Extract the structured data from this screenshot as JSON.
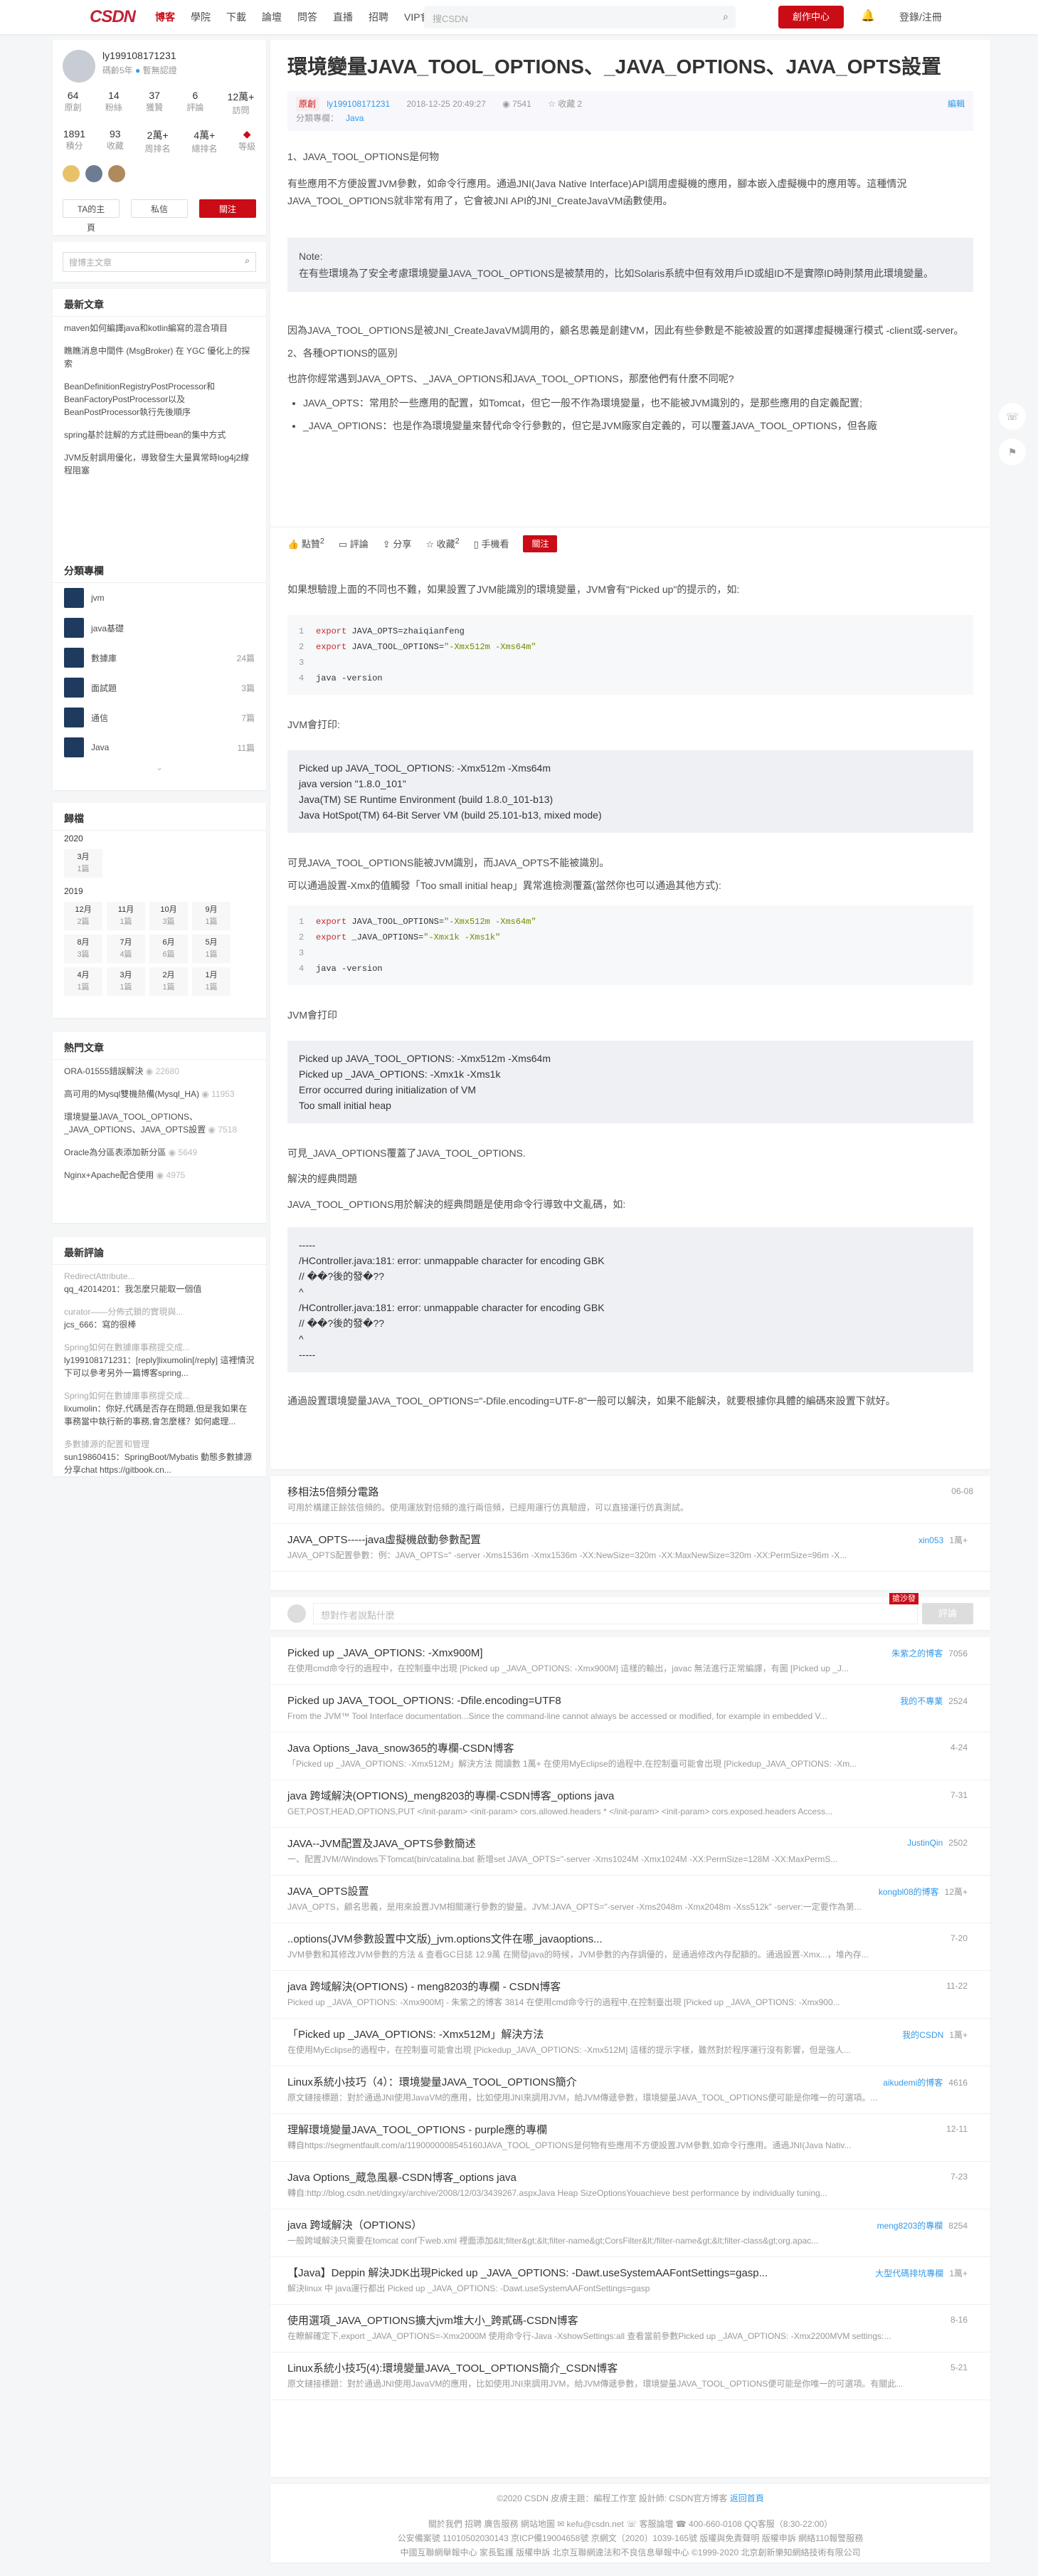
{
  "topbar": {
    "logo": "CSDN",
    "nav": [
      "博客",
      "學院",
      "下載",
      "論壇",
      "問答",
      "直播",
      "招聘",
      "VIP會員"
    ],
    "search_placeholder": "搜CSDN",
    "creator": "創作中心",
    "login": "登錄/注冊"
  },
  "author": {
    "name": "ly199108171231",
    "code_age": "碼齡5年",
    "badge": "暫無認證",
    "stats": [
      {
        "v": "64",
        "l": "原創"
      },
      {
        "v": "14",
        "l": "粉絲"
      },
      {
        "v": "37",
        "l": "獲贊"
      },
      {
        "v": "6",
        "l": "評論"
      },
      {
        "v": "12萬+",
        "l": "訪問"
      }
    ],
    "stats2": [
      {
        "v": "1891",
        "l": "積分"
      },
      {
        "v": "93",
        "l": "收藏"
      },
      {
        "v": "2萬+",
        "l": "周排名"
      },
      {
        "v": "4萬+",
        "l": "總排名"
      },
      {
        "v": "",
        "l": "等級"
      }
    ],
    "btn_home": "TA的主頁",
    "btn_msg": "私信",
    "btn_follow": "關注"
  },
  "sidebar_search": "搜博主文章",
  "recent": {
    "title": "最新文章",
    "items": [
      "maven如何編譯java和kotlin編寫的混合項目",
      "瞧瞧消息中間件 (MsgBroker) 在 YGC 優化上的探索",
      "BeanDefinitionRegistryPostProcessor和BeanFactoryPostProcessor以及BeanPostProcessor執行先後順序",
      "spring基於註解的方式註冊bean的集中方式",
      "JVM反射調用優化，導致發生大量異常時log4j2線程阻塞"
    ]
  },
  "categories": {
    "title": "分類專欄",
    "items": [
      {
        "n": "jvm",
        "c": ""
      },
      {
        "n": "java基礎",
        "c": ""
      },
      {
        "n": "數據庫",
        "c": "24篇"
      },
      {
        "n": "面試題",
        "c": "3篇"
      },
      {
        "n": "通信",
        "c": "7篇"
      },
      {
        "n": "Java",
        "c": "11篇"
      }
    ]
  },
  "archive": {
    "title": "歸檔",
    "years": [
      {
        "y": "2020",
        "m": [
          {
            "m": "3月",
            "c": "1篇"
          }
        ]
      },
      {
        "y": "2019",
        "m": [
          {
            "m": "12月",
            "c": "2篇"
          },
          {
            "m": "11月",
            "c": "1篇"
          },
          {
            "m": "10月",
            "c": "3篇"
          },
          {
            "m": "9月",
            "c": "1篇"
          },
          {
            "m": "8月",
            "c": "3篇"
          },
          {
            "m": "7月",
            "c": "4篇"
          },
          {
            "m": "6月",
            "c": "6篇"
          },
          {
            "m": "5月",
            "c": "1篇"
          },
          {
            "m": "4月",
            "c": "1篇"
          },
          {
            "m": "3月",
            "c": "1篇"
          },
          {
            "m": "2月",
            "c": "1篇"
          },
          {
            "m": "1月",
            "c": "1篇"
          }
        ]
      }
    ]
  },
  "hot": {
    "title": "熱門文章",
    "items": [
      {
        "t": "ORA-01555錯誤解決",
        "v": "22680"
      },
      {
        "t": "高可用的Mysql雙機熱備(Mysql_HA)",
        "v": "11953"
      },
      {
        "t": "環境變量JAVA_TOOL_OPTIONS、_JAVA_OPTIONS、JAVA_OPTS設置",
        "v": "7518"
      },
      {
        "t": "Oracle為分區表添加新分區",
        "v": "5649"
      },
      {
        "t": "Nginx+Apache配合使用",
        "v": "4975"
      }
    ]
  },
  "comments": {
    "title": "最新評論",
    "items": [
      {
        "a": "RedirectAttribute...",
        "t": "qq_42014201：我怎麼只能取一個值"
      },
      {
        "a": "curator——分佈式鎖的實現與...",
        "t": "jcs_666：寫的很棒"
      },
      {
        "a": "Spring如何在數據庫事務提交成...",
        "t": "ly199108171231：[reply]lixumolin[/reply] 這裡情況下可以參考另外一篇博客spring..."
      },
      {
        "a": "Spring如何在數據庫事務提交成...",
        "t": "lixumolin：你好,代碼是否存在問題,但是我如果在事務當中執行新的事務,會怎麼樣？如何處理..."
      },
      {
        "a": "多數據源的配置和管理",
        "t": "sun19860415：SpringBoot/Mybatis 動態多數據源分享chat https://gitbook.cn..."
      }
    ]
  },
  "article": {
    "title": "環境變量JAVA_TOOL_OPTIONS、_JAVA_OPTIONS、JAVA_OPTS設置",
    "tag": "原創",
    "author": "ly199108171231",
    "date": "2018-12-25 20:49:27",
    "views": "7541",
    "fav": "收藏 2",
    "edit": "編輯",
    "col_label": "分類專欄：",
    "col": "Java",
    "s1": "1、JAVA_TOOL_OPTIONS是何物",
    "p1": "有些應用不方便設置JVM參數，如命令行應用。通過JNI(Java Native Interface)API調用虛擬機的應用，腳本嵌入虛擬機中的應用等。這種情況JAVA_TOOL_OPTIONS就非常有用了，它會被JNI API的JNI_CreateJavaVM函數使用。",
    "note": [
      "Note:",
      "在有些環境為了安全考慮環境變量JAVA_TOOL_OPTIONS是被禁用的，比如Solaris系統中但有效用戶ID或組ID不是實際ID時則禁用此環境變量。"
    ],
    "p2": "因為JAVA_TOOL_OPTIONS是被JNI_CreateJavaVM調用的，顧名思義是創建VM，因此有些參數是不能被設置的如選擇虛擬機運行模式 -client或-server。",
    "s2": "2、各種OPTIONS的區別",
    "p3": "也許你經常遇到JAVA_OPTS、_JAVA_OPTIONS和JAVA_TOOL_OPTIONS，那麼他們有什麼不同呢?",
    "b1": "JAVA_OPTS：常用於一些應用的配置，如Tomcat，但它一般不作為環境變量，也不能被JVM識別的，是那些應用的自定義配置;",
    "b2": "_JAVA_OPTIONS：也是作為環境變量來替代命令行參數的，但它是JVM廠家自定義的，可以覆蓋JAVA_TOOL_OPTIONS，但各廠",
    "p4": "如果想驗證上面的不同也不難，如果設置了JVM能識別的環境變量，JVM會有\"Picked up\"的提示的，如:",
    "code1": [
      [
        "1",
        "export ",
        "JAVA_OPTS=zhaiqianfeng",
        ""
      ],
      [
        "2",
        "export ",
        "JAVA_TOOL_OPTIONS=",
        "\"-Xmx512m -Xms64m\""
      ],
      [
        "3",
        "",
        "",
        ""
      ],
      [
        "4",
        "",
        "java -version",
        ""
      ]
    ],
    "p5": "JVM會打印:",
    "out1": [
      "Picked up JAVA_TOOL_OPTIONS: -Xmx512m -Xms64m",
      "java version \"1.8.0_101\"",
      "Java(TM) SE Runtime Environment (build 1.8.0_101-b13)",
      "Java HotSpot(TM) 64-Bit Server VM (build 25.101-b13, mixed mode)"
    ],
    "p6": "可見JAVA_TOOL_OPTIONS能被JVM識別，而JAVA_OPTS不能被識別。",
    "p7": "可以通過設置-Xmx的值觸發「Too small initial heap」異常進檢測覆蓋(當然你也可以通過其他方式):",
    "code2": [
      [
        "1",
        "export ",
        "JAVA_TOOL_OPTIONS=",
        "\"-Xmx512m -Xms64m\""
      ],
      [
        "2",
        "export ",
        "_JAVA_OPTIONS=",
        "\"-Xmx1k -Xms1k\""
      ],
      [
        "3",
        "",
        "",
        ""
      ],
      [
        "4",
        "",
        "java -version",
        ""
      ]
    ],
    "p8": "JVM會打印",
    "out2": [
      "Picked up JAVA_TOOL_OPTIONS: -Xmx512m -Xms64m",
      "Picked up _JAVA_OPTIONS: -Xmx1k -Xms1k",
      "Error occurred during initialization of VM",
      "Too small initial heap"
    ],
    "p9": "可見_JAVA_OPTIONS覆蓋了JAVA_TOOL_OPTIONS.",
    "s3": "解決的經典問題",
    "p10": "JAVA_TOOL_OPTIONS用於解決的經典問題是使用命令行導致中文亂碼，如:",
    "out3": [
      "-----",
      "/HController.java:181: error: unmappable character for encoding GBK",
      "// ��?後的發�??",
      "^",
      "/HController.java:181: error: unmappable character for encoding GBK",
      "// ��?後的發�??",
      "^",
      "-----"
    ],
    "p11": "通過設置環境變量JAVA_TOOL_OPTIONS=\"-Dfile.encoding=UTF-8\"一般可以解決，如果不能解決，就要根據你具體的編碼來設置下就好。"
  },
  "actions": {
    "like": "點贊",
    "like_n": "2",
    "comment": "評論",
    "share": "分享",
    "fav": "收藏",
    "fav_n": "2",
    "phone": "手機看",
    "follow": "關注"
  },
  "recbox": [
    {
      "t": "移相法5倍頻分電路",
      "d": "可用於構建正餘弦倍頻的。使用運放對倍頻的進行兩倍頻，已經用運行仿真驗證，可以直接運行仿真測試。",
      "r": "06-08",
      "a": ""
    },
    {
      "t": "JAVA_OPTS-----java虛擬機啟動參數配置",
      "d": "JAVA_OPTS配置參數：例：JAVA_OPTS=\" -server -Xms1536m -Xmx1536m -XX:NewSize=320m -XX:MaxNewSize=320m -XX:PermSize=96m -X...",
      "r": "1萬+",
      "a": "xin053"
    }
  ],
  "comment_box": {
    "placeholder": "想對作者說點什麼",
    "btn": "評論",
    "badge": "搶沙發"
  },
  "recs": [
    {
      "t": "Picked up _JAVA_OPTIONS: -Xmx900M]",
      "d": "在使用cmd命令行的過程中，在控制臺中出現 [Picked up _JAVA_OPTIONS: -Xmx900M] 這樣的輸出，javac 無法進行正常編譯，有圖 [Picked up _J...",
      "a": "朱紫之的博客",
      "r": "7056"
    },
    {
      "t": "Picked up JAVA_TOOL_OPTIONS: -Dfile.encoding=UTF8",
      "d": "From the JVM™ Tool Interface documentation...Since the command-line cannot always be accessed or modified, for example in embedded V...",
      "a": "我的不專業",
      "r": "2524"
    },
    {
      "t": "Java Options_Java_snow365的專欄-CSDN博客",
      "d": "「Picked up _JAVA_OPTIONS: -Xmx512M」解決方法 閱讀數 1萬+ 在使用MyEclipse的過程中,在控制臺可能會出現 [Pickedup_JAVA_OPTIONS: -Xm...",
      "a": "",
      "r": "4-24"
    },
    {
      "t": "java 跨域解決(OPTIONS)_meng8203的專欄-CSDN博客_options java",
      "d": "GET,POST,HEAD,OPTIONS,PUT </init-param> <init-param> cors.allowed.headers * </init-param> <init-param> cors.exposed.headers Access...",
      "a": "",
      "r": "7-31"
    },
    {
      "t": "JAVA--JVM配置及JAVA_OPTS參數簡述",
      "d": "一、配置JVM//Windows下Tomcat(bin/catalina.bat 新增set JAVA_OPTS=\"-server -Xms1024M -Xmx1024M -XX:PermSize=128M -XX:MaxPermS...",
      "a": "JustinQin",
      "r": "2502"
    },
    {
      "t": "JAVA_OPTS設置",
      "d": "JAVA_OPTS，顧名思義，是用來設置JVM相關運行參數的變量。JVM:JAVA_OPTS=\"-server -Xms2048m -Xmx2048m -Xss512k\" -server:一定要作為第...",
      "a": "kongbl08的博客",
      "r": "12萬+"
    },
    {
      "t": "..options(JVM參數設置中文版)_jvm.options文件在哪_javaoptions...",
      "d": "JVM參數和其修改JVM參數的方法 & 查看GC日誌 12.9萬 在開發java的時候，JVM參數的內存調優的，是通過修改內存配額的。通過設置-Xmx...，堆內存...",
      "a": "",
      "r": "7-20"
    },
    {
      "t": "java 跨域解決(OPTIONS) - meng8203的專欄 - CSDN博客",
      "d": "Picked up _JAVA_OPTIONS: -Xmx900M] - 朱紫之的博客 3814 在使用cmd命令行的過程中,在控制臺出現 [Picked up _JAVA_OPTIONS: -Xmx900...",
      "a": "",
      "r": "11-22"
    },
    {
      "t": "「Picked up _JAVA_OPTIONS: -Xmx512M」解決方法",
      "d": "在使用MyEclipse的過程中，在控制臺可能會出現 [Pickedup_JAVA_OPTIONS: -Xmx512M] 這樣的提示字樣，雖然對於程序運行沒有影響，但是強人...",
      "a": "我的CSDN",
      "r": "1萬+"
    },
    {
      "t": "Linux系統小技巧（4）：環境變量JAVA_TOOL_OPTIONS簡介",
      "d": "原文鏈接標題：對於通過JNI使用JavaVM的應用，比如使用JNI來調用JVM，給JVM傳遞參數，環境變量JAVA_TOOL_OPTIONS便可能是你唯一的可選項。...",
      "a": "aikudemi的博客",
      "r": "4616"
    },
    {
      "t": "理解環境變量JAVA_TOOL_OPTIONS - purple應的專欄",
      "d": "轉自https://segmentfault.com/a/1190000008545160JAVA_TOOL_OPTIONS是何物有些應用不方便設置JVM參數,如命令行應用。通過JNI(Java Nativ...",
      "a": "",
      "r": "12-11"
    },
    {
      "t": "Java Options_蔵急風暴-CSDN博客_options java",
      "d": "轉自:http://blog.csdn.net/dingxy/archive/2008/12/03/3439267.aspxJava Heap SizeOptionsYouachieve best performance by individually tuning...",
      "a": "",
      "r": "7-23"
    },
    {
      "t": "java 跨域解決（OPTIONS）",
      "d": "一般跨域解決只需要在tomcat conf下web.xml 裡面添加&lt;filter&gt;&lt;filter-name&gt;CorsFilter&lt;/filter-name&gt;&lt;filter-class&gt;org.apac...",
      "a": "meng8203的專欄",
      "r": "8254"
    },
    {
      "t": "【Java】Deppin 解決JDK出現Picked up _JAVA_OPTIONS: -Dawt.useSystemAAFontSettings=gasp...",
      "d": "解決linux 中 java運行都出 Picked up _JAVA_OPTIONS: -Dawt.useSystemAAFontSettings=gasp",
      "a": "大型代碼排坑專欄",
      "r": "1萬+"
    },
    {
      "t": "使用選項_JAVA_OPTIONS擴大jvm堆大小_跨貳碼-CSDN博客",
      "d": "在瞭解確定下,export _JAVA_OPTIONS=-Xmx2000M 使用命令行-Java -XshowSettings:all 查看當前參數Picked up _JAVA_OPTIONS: -Xmx2200MVM settings:...",
      "a": "",
      "r": "8-16"
    },
    {
      "t": "Linux系統小技巧(4):環境變量JAVA_TOOL_OPTIONS簡介_CSDN博客",
      "d": "原文鏈接標題：對於通過JNI使用JavaVM的應用，比如使用JNI來調用JVM，給JVM傳遞參數，環境變量JAVA_TOOL_OPTIONS便可能是你唯一的可選項。有關此...",
      "a": "",
      "r": "5-21"
    }
  ],
  "footer": {
    "copyright": "©2020 CSDN  皮膚主題：編程工作室  設計師: CSDN官方博客",
    "back": "返回首頁",
    "links": "關於我們   招聘   廣告服務   網站地圖   ✉ kefu@csdn.net   ☏ 客服論壇   ☎ 400-660-0108   QQ客服（8:30-22:00）",
    "lic1": "公安備案號 11010502030143   京ICP備19004658號   京網文〔2020〕1039-165號   版權與免責聲明   版權申訴   網絡110報警服務",
    "lic2": "中國互聯網舉報中心   家長監護   版權申訴   北京互聯網違法和不良信息舉報中心   ©1999-2020 北京創新樂知網絡技術有限公司"
  },
  "colors": {
    "brand": "#ca0c16",
    "link": "#3399ea"
  }
}
